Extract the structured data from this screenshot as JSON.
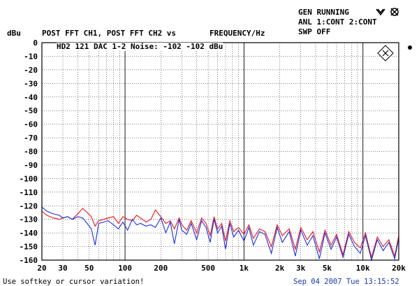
{
  "header": {
    "gen_status": "GEN RUNNING",
    "anl_status": "ANL 1:CONT 2:CONT",
    "swp_status": "SWP OFF"
  },
  "y_unit": "dBu",
  "trace_title": "POST FFT CH1, POST FFT CH2 vs",
  "x_title": "FREQUENCY/Hz",
  "annotation": "HD2 121 DAC 1-2 Noise: -102 -102 dBu",
  "status": {
    "message": "Use softkey or cursor variation!",
    "datetime": "Sep 04 2007 Tue 13:15:52"
  },
  "chart_data": {
    "type": "line",
    "x_scale": "log",
    "xlim": [
      20,
      20000
    ],
    "ylim": [
      -160,
      0
    ],
    "grid": true,
    "ylabel": "dBu",
    "xlabel": "FREQUENCY/Hz",
    "x_tick_labels": [
      "20",
      "30",
      "50",
      "100",
      "200",
      "500",
      "1k",
      "2k",
      "3k",
      "5k",
      "10k",
      "20k"
    ],
    "x_tick_values": [
      20,
      30,
      50,
      100,
      200,
      500,
      1000,
      2000,
      3000,
      5000,
      10000,
      20000
    ],
    "y_ticks": [
      0,
      -10,
      -20,
      -30,
      -40,
      -50,
      -60,
      -70,
      -80,
      -90,
      -100,
      -110,
      -120,
      -130,
      -140,
      -150,
      -160
    ],
    "series": [
      {
        "name": "CH1",
        "color": "#e8141a",
        "x": [
          20,
          22,
          25,
          28,
          30,
          33,
          36,
          40,
          44,
          48,
          52,
          56,
          60,
          66,
          72,
          80,
          88,
          96,
          105,
          115,
          125,
          135,
          150,
          165,
          180,
          200,
          220,
          240,
          260,
          285,
          300,
          330,
          360,
          400,
          440,
          480,
          520,
          560,
          600,
          650,
          700,
          760,
          820,
          900,
          1000,
          1100,
          1200,
          1350,
          1500,
          1700,
          1900,
          2100,
          2400,
          2700,
          3000,
          3400,
          3800,
          4300,
          4800,
          5400,
          6000,
          6800,
          7600,
          8500,
          9500,
          10500,
          11800,
          13200,
          14800,
          16500,
          18500,
          20000
        ],
        "values": [
          -124,
          -127,
          -129,
          -130,
          -129,
          -128,
          -130,
          -126,
          -122,
          -125,
          -128,
          -135,
          -131,
          -130,
          -129,
          -128,
          -133,
          -128,
          -130,
          -131,
          -127,
          -129,
          -132,
          -130,
          -123,
          -128,
          -133,
          -131,
          -137,
          -129,
          -134,
          -138,
          -131,
          -140,
          -129,
          -133,
          -142,
          -128,
          -137,
          -133,
          -146,
          -131,
          -139,
          -136,
          -141,
          -134,
          -144,
          -137,
          -139,
          -150,
          -134,
          -142,
          -137,
          -152,
          -136,
          -145,
          -139,
          -154,
          -138,
          -149,
          -141,
          -156,
          -139,
          -147,
          -151,
          -140,
          -158,
          -143,
          -150,
          -145,
          -157,
          -142
        ]
      },
      {
        "name": "CH2",
        "color": "#1a2ee0",
        "x": [
          20,
          22,
          25,
          28,
          30,
          33,
          36,
          40,
          44,
          48,
          52,
          56,
          60,
          66,
          72,
          80,
          88,
          96,
          105,
          115,
          125,
          135,
          150,
          165,
          180,
          200,
          220,
          240,
          260,
          285,
          300,
          330,
          360,
          400,
          440,
          480,
          520,
          560,
          600,
          650,
          700,
          760,
          820,
          900,
          1000,
          1100,
          1200,
          1350,
          1500,
          1700,
          1900,
          2100,
          2400,
          2700,
          3000,
          3400,
          3800,
          4300,
          4800,
          5400,
          6000,
          6800,
          7600,
          8500,
          9500,
          10500,
          11800,
          13200,
          14800,
          16500,
          18500,
          20000
        ],
        "values": [
          -121,
          -124,
          -126,
          -127,
          -129,
          -128,
          -130,
          -128,
          -129,
          -133,
          -137,
          -149,
          -133,
          -132,
          -131,
          -134,
          -137,
          -132,
          -138,
          -130,
          -134,
          -133,
          -135,
          -134,
          -136,
          -129,
          -140,
          -132,
          -148,
          -130,
          -138,
          -141,
          -133,
          -145,
          -131,
          -136,
          -147,
          -130,
          -140,
          -135,
          -152,
          -133,
          -143,
          -138,
          -146,
          -136,
          -149,
          -139,
          -141,
          -155,
          -136,
          -147,
          -139,
          -157,
          -138,
          -149,
          -142,
          -159,
          -140,
          -152,
          -143,
          -158,
          -141,
          -150,
          -155,
          -142,
          -160,
          -145,
          -153,
          -147,
          -159,
          -144
        ]
      }
    ]
  }
}
